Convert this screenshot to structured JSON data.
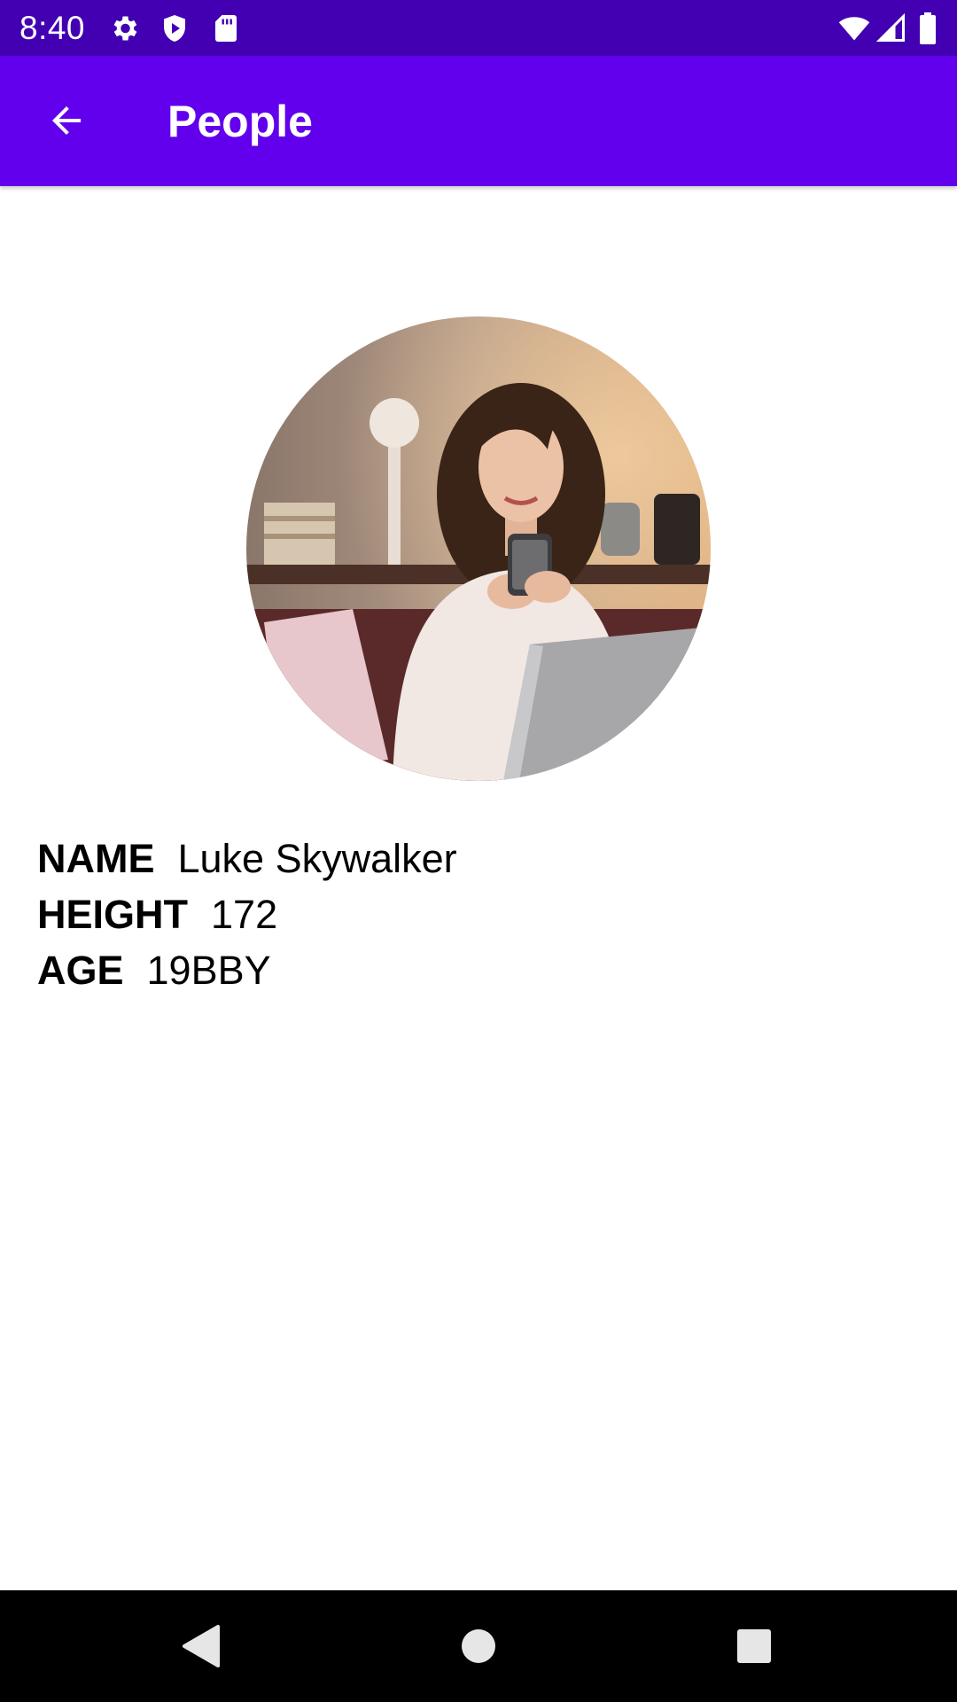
{
  "status_bar": {
    "time": "8:40",
    "left_icons": [
      "settings-icon",
      "shield-play-icon",
      "sd-card-icon"
    ],
    "right_icons": [
      "wifi-icon",
      "cell-signal-icon",
      "battery-icon"
    ],
    "color": "#4300b3"
  },
  "app_bar": {
    "title": "People",
    "back_icon": "arrow-back-icon",
    "color": "#6200ee"
  },
  "person": {
    "photo": "profile-photo",
    "name_label": "NAME",
    "name_value": "Luke Skywalker",
    "height_label": "HEIGHT",
    "height_value": "172",
    "age_label": "AGE",
    "age_value": "19BBY"
  },
  "nav_bar": {
    "buttons": [
      "back-triangle-icon",
      "home-circle-icon",
      "recents-square-icon"
    ]
  }
}
